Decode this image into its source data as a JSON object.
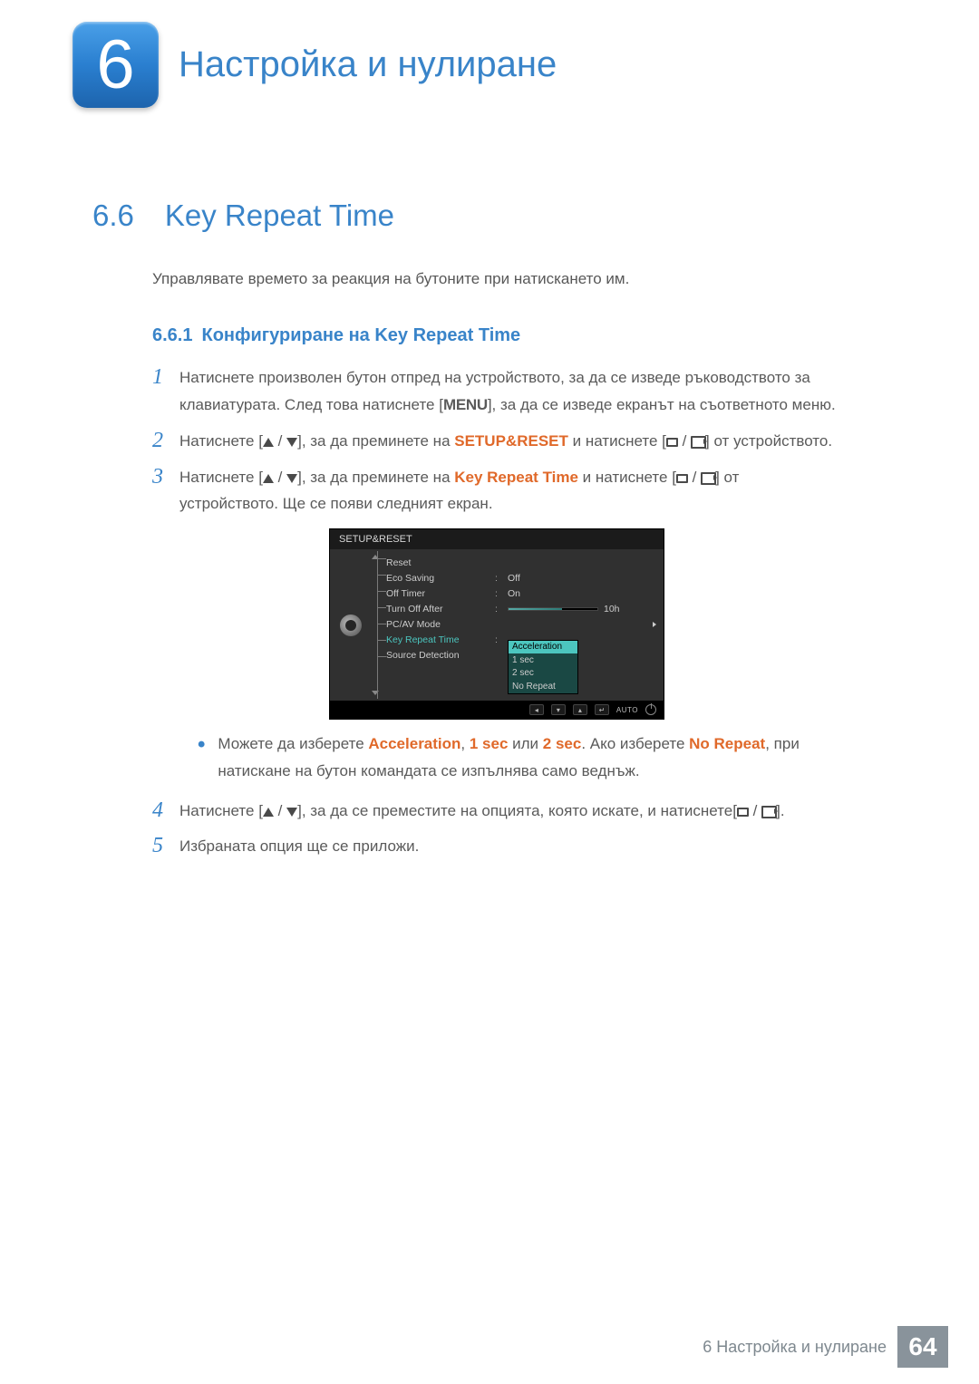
{
  "chapter": {
    "number": "6",
    "title": "Настройка и нулиране"
  },
  "section": {
    "number": "6.6",
    "title": "Key Repeat Time"
  },
  "intro": "Управлявате времето за реакция на бутоните при натискането им.",
  "subsection": {
    "number": "6.6.1",
    "title": "Конфигуриране на Key Repeat Time"
  },
  "steps": {
    "s1": {
      "text_a": "Натиснете произволен бутон отпред на устройството, за да се изведе ръководството за клавиатурата. След това натиснете [",
      "menu": "MENU",
      "text_b": "], за да се изведе екранът на съответното меню."
    },
    "s2": {
      "text_a": "Натиснете [",
      "text_b": "], за да преминете на ",
      "kw": "SETUP&RESET",
      "text_c": " и натиснете [",
      "text_d": "] от устройството."
    },
    "s3": {
      "text_a": "Натиснете [",
      "text_b": "], за да преминете на ",
      "kw": "Key Repeat Time",
      "text_c": " и натиснете [",
      "text_d": "] от устройството. Ще се появи следният екран."
    },
    "bullet": {
      "text_a": "Можете да изберете ",
      "opt1": "Acceleration",
      "sep1": ", ",
      "opt2": "1 sec",
      "sep2": " или ",
      "opt3": "2 sec",
      "text_b": ". Ако изберете ",
      "opt4": "No Repeat",
      "text_c": ", при натискане на бутон командата се изпълнява само веднъж."
    },
    "s4": {
      "text_a": "Натиснете [",
      "text_b": "], за да се преместите на опцията, която искате, и натиснете[",
      "text_c": "]."
    },
    "s5": {
      "text": "Избраната опция ще се приложи."
    }
  },
  "step_numbers": {
    "n1": "1",
    "n2": "2",
    "n3": "3",
    "n4": "4",
    "n5": "5"
  },
  "osd": {
    "title": "SETUP&RESET",
    "rows": {
      "reset": "Reset",
      "eco": "Eco Saving",
      "eco_val": "Off",
      "offtimer": "Off Timer",
      "offtimer_val": "On",
      "turnoff": "Turn Off After",
      "turnoff_val": "10h",
      "pcav": "PC/AV Mode",
      "krt": "Key Repeat Time",
      "src": "Source Detection"
    },
    "popup": [
      "Acceleration",
      "1 sec",
      "2 sec",
      "No Repeat"
    ],
    "footer_auto": "AUTO"
  },
  "footer": {
    "chapter_label": "6 Настройка и нулиране",
    "page": "64"
  }
}
